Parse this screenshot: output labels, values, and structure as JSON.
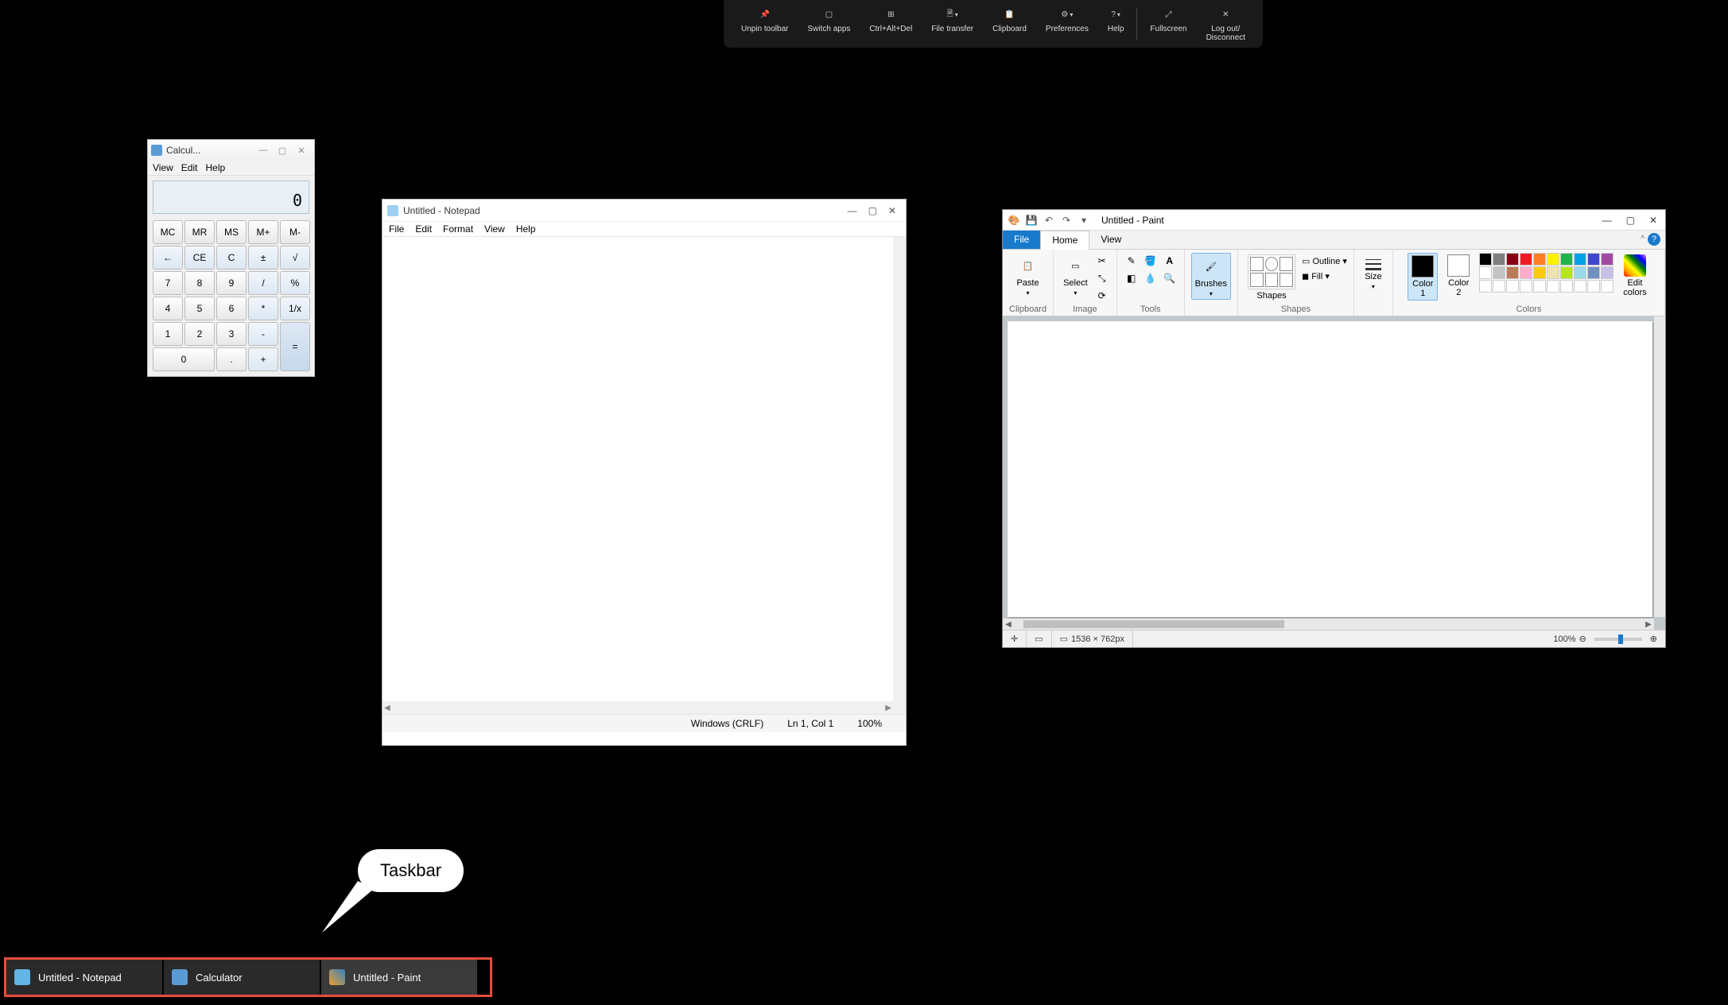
{
  "remote_toolbar": {
    "items": [
      {
        "label": "Unpin toolbar",
        "icon": "pin"
      },
      {
        "label": "Switch apps",
        "icon": "apps"
      },
      {
        "label": "Ctrl+Alt+Del",
        "icon": "grid"
      },
      {
        "label": "File transfer",
        "icon": "file",
        "dropdown": true
      },
      {
        "label": "Clipboard",
        "icon": "clipboard"
      },
      {
        "label": "Preferences",
        "icon": "prefs",
        "dropdown": true
      },
      {
        "label": "Help",
        "icon": "help",
        "dropdown": true
      },
      {
        "label": "Fullscreen",
        "icon": "fullscreen"
      },
      {
        "label": "Log out/\nDisconnect",
        "icon": "close"
      }
    ]
  },
  "calculator": {
    "title": "Calcul...",
    "menu": [
      "View",
      "Edit",
      "Help"
    ],
    "display": "0",
    "buttons": [
      [
        "MC",
        "MR",
        "MS",
        "M+",
        "M-"
      ],
      [
        "←",
        "CE",
        "C",
        "±",
        "√"
      ],
      [
        "7",
        "8",
        "9",
        "/",
        "%"
      ],
      [
        "4",
        "5",
        "6",
        "*",
        "1/x"
      ],
      [
        "1",
        "2",
        "3",
        "-",
        "="
      ],
      [
        "0",
        ".",
        "+"
      ]
    ]
  },
  "notepad": {
    "title": "Untitled - Notepad",
    "menu": [
      "File",
      "Edit",
      "Format",
      "View",
      "Help"
    ],
    "status": {
      "encoding": "Windows (CRLF)",
      "position": "Ln 1, Col 1",
      "zoom": "100%"
    }
  },
  "paint": {
    "title": "Untitled - Paint",
    "tabs": {
      "file": "File",
      "home": "Home",
      "view": "View"
    },
    "ribbon": {
      "clipboard": {
        "label": "Clipboard",
        "paste": "Paste"
      },
      "image": {
        "label": "Image",
        "select": "Select"
      },
      "tools": {
        "label": "Tools"
      },
      "brushes": {
        "label": "Brushes",
        "btn": "Brushes"
      },
      "shapes": {
        "label": "Shapes",
        "btn": "Shapes",
        "outline": "Outline",
        "fill": "Fill"
      },
      "size": {
        "label": "Size",
        "btn": "Size"
      },
      "colors": {
        "label": "Colors",
        "c1": "Color\n1",
        "c2": "Color\n2",
        "edit": "Edit\ncolors"
      }
    },
    "palette_row1": [
      "#000000",
      "#7f7f7f",
      "#880015",
      "#ed1c24",
      "#ff7f27",
      "#fff200",
      "#22b14c",
      "#00a2e8",
      "#3f48cc",
      "#a349a4"
    ],
    "palette_row2": [
      "#ffffff",
      "#c3c3c3",
      "#b97a57",
      "#ffaec9",
      "#ffc90e",
      "#efe4b0",
      "#b5e61d",
      "#99d9ea",
      "#7092be",
      "#c8bfe7"
    ],
    "palette_row3": [
      "#ffffff",
      "#ffffff",
      "#ffffff",
      "#ffffff",
      "#ffffff",
      "#ffffff",
      "#ffffff",
      "#ffffff",
      "#ffffff",
      "#ffffff"
    ],
    "color1": "#000000",
    "color2": "#ffffff",
    "status": {
      "dimensions": "1536 × 762px",
      "zoom": "100%"
    }
  },
  "taskbar": {
    "items": [
      {
        "label": "Untitled - Notepad",
        "color": "#62b5e5"
      },
      {
        "label": "Calculator",
        "color": "#5b9bd5"
      },
      {
        "label": "Untitled - Paint",
        "color": "#f0a030"
      }
    ]
  },
  "callout": {
    "text": "Taskbar"
  }
}
